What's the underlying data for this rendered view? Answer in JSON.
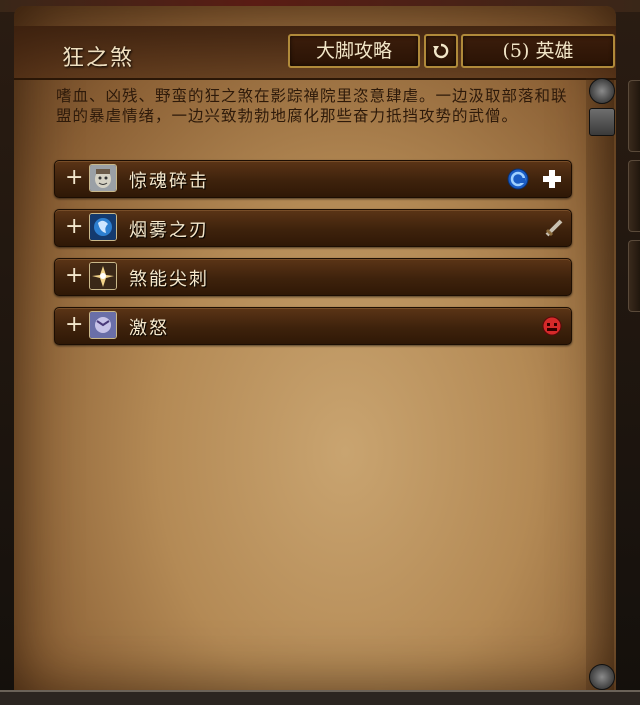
{
  "header": {
    "title": "狂之煞",
    "guide_button": "大脚攻略",
    "refresh_icon": "refresh-icon",
    "difficulty_button": "(5) 英雄"
  },
  "description": "嗜血、凶残、野蛮的狂之煞在影踪禅院里恣意肆虐。一边汲取部落和联盟的暴虐情绪，一边兴致勃勃地腐化那些奋力抵挡攻势的武僧。",
  "abilities": [
    {
      "expand": "+",
      "label": "惊魂碎击",
      "icon": "shattering-blow-icon",
      "flags": [
        "interrupt-icon",
        "healer-icon"
      ]
    },
    {
      "expand": "+",
      "label": "烟雾之刃",
      "icon": "smoke-blades-icon",
      "flags": [
        "dps-sword-icon"
      ]
    },
    {
      "expand": "+",
      "label": "煞能尖刺",
      "icon": "sha-spike-icon",
      "flags": []
    },
    {
      "expand": "+",
      "label": "激怒",
      "icon": "enrage-icon",
      "flags": [
        "enrage-flag-icon"
      ]
    }
  ],
  "colors": {
    "interrupt": "#2a7fe0",
    "enrage": "#d42a2a",
    "button_border": "#b08a3a"
  }
}
